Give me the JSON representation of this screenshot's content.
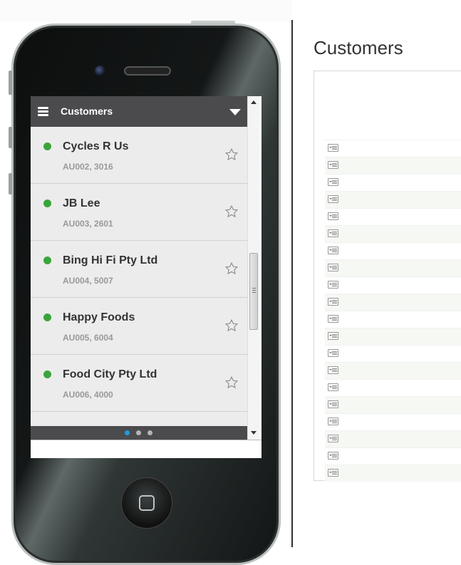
{
  "panel": {
    "title": "Customers"
  },
  "app": {
    "header_title": "Customers",
    "customers": [
      {
        "name": "Cycles R Us",
        "subtitle": "AU002, 3016",
        "status_color": "#3aa53a"
      },
      {
        "name": "JB Lee",
        "subtitle": "AU003, 2601",
        "status_color": "#3aa53a"
      },
      {
        "name": "Bing Hi Fi Pty Ltd",
        "subtitle": "AU004, 5007",
        "status_color": "#3aa53a"
      },
      {
        "name": "Happy Foods",
        "subtitle": "AU005, 6004",
        "status_color": "#3aa53a"
      },
      {
        "name": "Food City Pty Ltd",
        "subtitle": "AU006, 4000",
        "status_color": "#3aa53a"
      }
    ],
    "pager": {
      "pages": 3,
      "active_page": 1
    }
  },
  "grid": {
    "row_count": 20,
    "row_icon": "row-details-icon"
  },
  "colors": {
    "header_bg": "#4b4b4d",
    "list_bg": "#ececec",
    "status_green": "#3aa53a",
    "pager_active": "#1e9be0"
  }
}
